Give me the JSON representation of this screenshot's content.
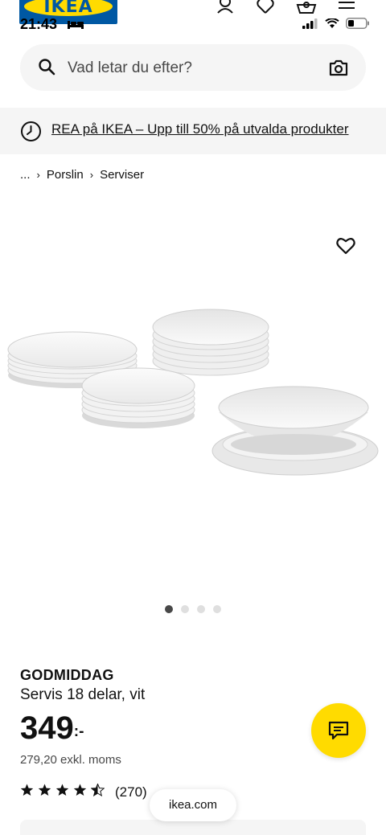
{
  "header": {
    "logo_text": "IKEA",
    "time": "21:43",
    "nav_icons": [
      "account-icon",
      "heart-icon",
      "basket-icon",
      "menu-icon"
    ]
  },
  "search": {
    "placeholder": "Vad letar du efter?"
  },
  "promo": {
    "link": "REA på IKEA – Upp till 50% på utvalda produkter"
  },
  "breadcrumb": {
    "ellipsis": "...",
    "items": [
      "Porslin",
      "Serviser"
    ]
  },
  "gallery": {
    "image_count": 4,
    "active_index": 0
  },
  "product": {
    "name": "GODMIDDAG",
    "description": "Servis 18 delar, vit",
    "price": "349",
    "price_suffix": ":-",
    "price_excl": "279,20 exkl. moms",
    "rating": 4.5,
    "rating_count": "(270)"
  },
  "browser": {
    "url": "ikea.com"
  },
  "colors": {
    "brand_blue": "#0058a3",
    "brand_yellow": "#ffdb00",
    "panel_grey": "#f5f5f5"
  }
}
